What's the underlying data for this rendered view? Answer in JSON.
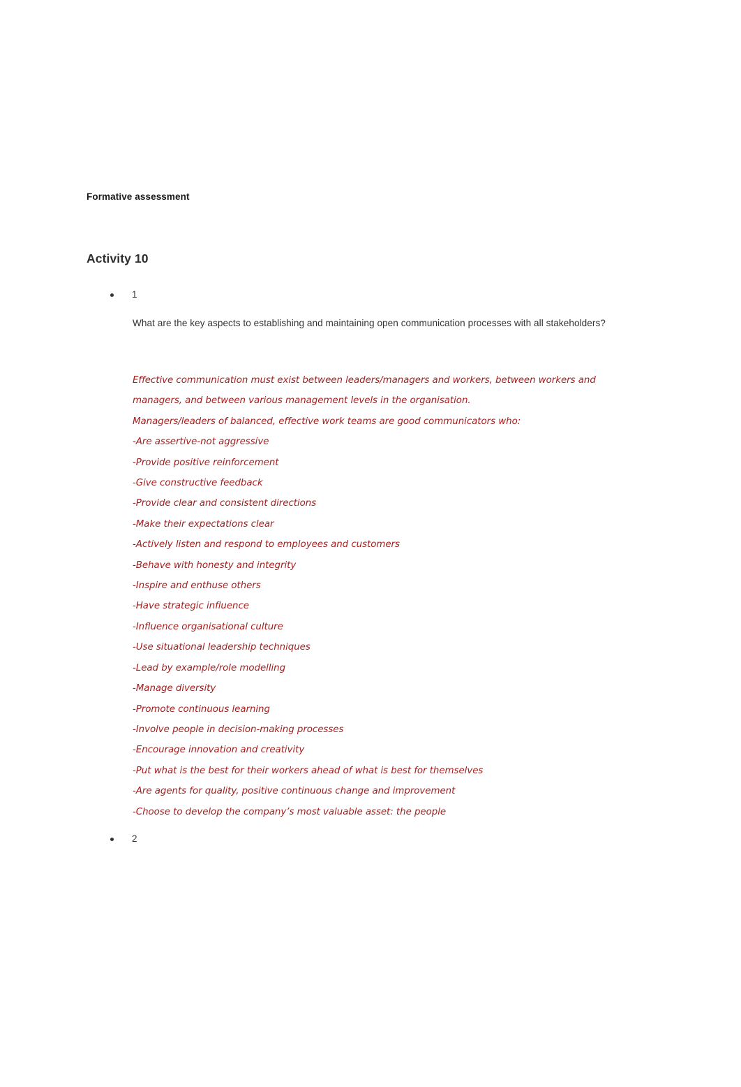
{
  "document": {
    "title": "Formative assessment",
    "activity_heading": "Activity 10"
  },
  "items": [
    {
      "number": "1",
      "question": "What are the key aspects to establishing and maintaining open communication processes with all stakeholders?",
      "answer": {
        "color": "#a32020",
        "intro_paragraph": "Effective communication must exist between leaders/managers and workers, between workers and managers, and between various management levels in the organisation.",
        "lead_in": "Managers/leaders of balanced, effective work teams are good communicators who:",
        "points": [
          "-Are assertive-not aggressive",
          "-Provide positive reinforcement",
          "-Give constructive feedback",
          "-Provide clear and consistent directions",
          "-Make their expectations clear",
          "-Actively listen and respond to employees and customers",
          "-Behave with honesty and integrity",
          "-Inspire and enthuse others",
          "-Have strategic influence",
          "-Influence organisational culture",
          "-Use situational leadership techniques",
          "-Lead by example/role modelling",
          "-Manage diversity",
          "-Promote continuous learning",
          "-Involve people in decision-making processes",
          "-Encourage innovation and creativity",
          "-Put what is the best for their workers ahead of what is best for themselves",
          "-Are agents for quality, positive continuous change and improvement",
          "-Choose to develop the company’s most valuable asset: the people"
        ]
      }
    },
    {
      "number": "2",
      "question": "",
      "answer": null
    }
  ]
}
